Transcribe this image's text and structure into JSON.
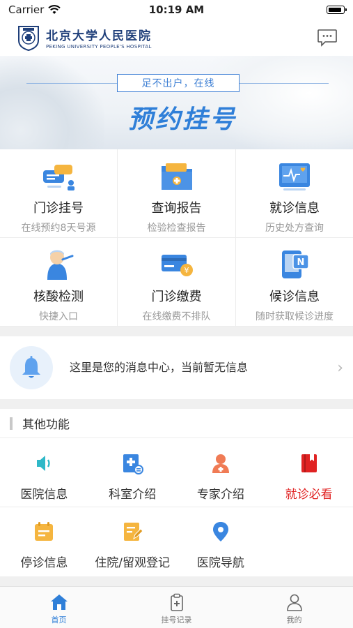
{
  "status_bar": {
    "carrier": "Carrier",
    "time": "10:19 AM"
  },
  "header": {
    "logo_cn": "北京大学人民医院",
    "logo_en": "PEKING UNIVERSITY PEOPLE'S HOSPITAL"
  },
  "banner": {
    "tagline": "足不出户，在线",
    "title": "预约挂号"
  },
  "services": [
    {
      "title": "门诊挂号",
      "subtitle": "在线预约8天号源",
      "icon": "appointment-icon"
    },
    {
      "title": "查询报告",
      "subtitle": "检验检查报告",
      "icon": "report-folder-icon"
    },
    {
      "title": "就诊信息",
      "subtitle": "历史处方查询",
      "icon": "medical-record-icon"
    },
    {
      "title": "核酸检测",
      "subtitle": "快捷入口",
      "icon": "nucleic-test-icon"
    },
    {
      "title": "门诊缴费",
      "subtitle": "在线缴费不排队",
      "icon": "payment-card-icon"
    },
    {
      "title": "候诊信息",
      "subtitle": "随时获取候诊进度",
      "icon": "queue-notice-icon"
    }
  ],
  "message_center": {
    "text": "这里是您的消息中心，当前暂无信息"
  },
  "other_functions": {
    "title": "其他功能",
    "items": [
      {
        "label": "医院信息",
        "icon": "speaker-icon",
        "color": "#2fb8c8"
      },
      {
        "label": "科室介绍",
        "icon": "department-icon",
        "color": "#3a86e0"
      },
      {
        "label": "专家介绍",
        "icon": "doctor-icon",
        "color": "#f07b55"
      },
      {
        "label": "就诊必看",
        "icon": "book-icon",
        "color": "#e02222"
      },
      {
        "label": "停诊信息",
        "icon": "calendar-icon",
        "color": "#f5b53f"
      },
      {
        "label": "住院/留观登记",
        "icon": "edit-form-icon",
        "color": "#f5b53f"
      },
      {
        "label": "医院导航",
        "icon": "location-pin-icon",
        "color": "#3a86e0"
      }
    ]
  },
  "tabbar": {
    "items": [
      {
        "label": "首页",
        "icon": "home-icon",
        "active": true
      },
      {
        "label": "挂号记录",
        "icon": "clipboard-icon",
        "active": false
      },
      {
        "label": "我的",
        "icon": "user-icon",
        "active": false
      }
    ]
  }
}
